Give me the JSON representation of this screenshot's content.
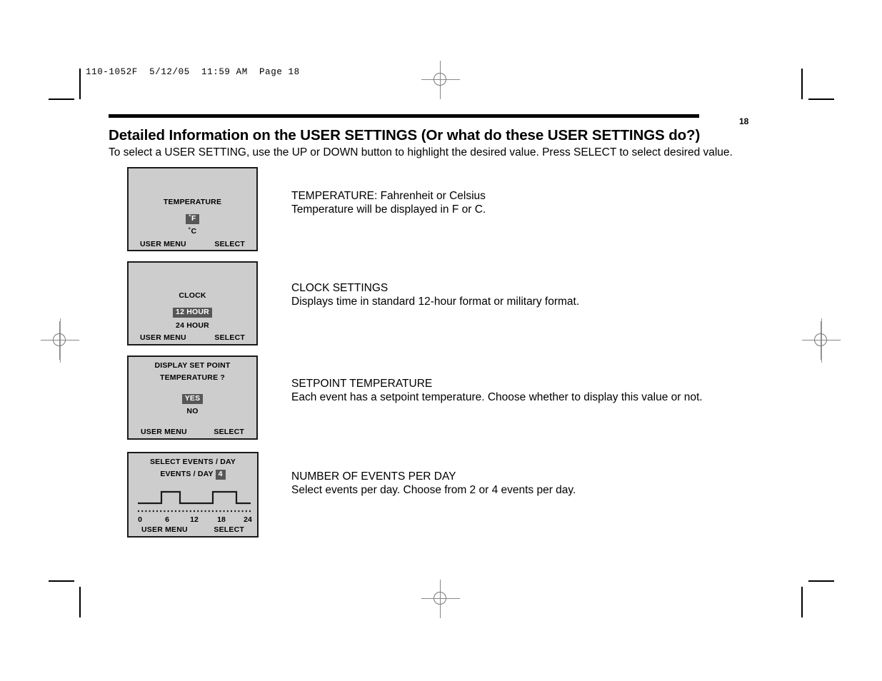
{
  "document": {
    "slug": "110-1052F  5/12/05  11:59 AM  Page 18",
    "page_number": "18",
    "title": "Detailed Information on the USER SETTINGS (Or what do these USER SETTINGS do?)",
    "subtitle": "To select a USER SETTING, use the UP or DOWN button to highlight the desired value. Press SELECT to select desired value."
  },
  "colors": {
    "panel_background": "#cdcdcd",
    "panel_border": "#1a1a1a",
    "highlight_background": "#575757",
    "highlight_text": "#ffffff",
    "page_background": "#ffffff",
    "text": "#000000",
    "crop_mark": "#000000",
    "registration_mark": "#888888"
  },
  "footer_buttons": {
    "left_label": "USER MENU",
    "right_label": "SELECT"
  },
  "panels": [
    {
      "id": "temperature",
      "title": "TEMPERATURE",
      "options": [
        {
          "label": "˚F",
          "selected": true
        },
        {
          "label": "˚C",
          "selected": false
        }
      ],
      "footer": {
        "left": "USER MENU",
        "right": "SELECT"
      }
    },
    {
      "id": "clock",
      "title": "CLOCK",
      "options": [
        {
          "label": "12 HOUR",
          "selected": true
        },
        {
          "label": "24 HOUR",
          "selected": false
        }
      ],
      "footer": {
        "left": "USER MENU",
        "right": "SELECT"
      }
    },
    {
      "id": "display-set-point",
      "title_line1": "DISPLAY SET POINT",
      "title_line2": "TEMPERATURE ?",
      "options": [
        {
          "label": "YES",
          "selected": true
        },
        {
          "label": "NO",
          "selected": false
        }
      ],
      "footer": {
        "left": "USER MENU",
        "right": "SELECT"
      }
    },
    {
      "id": "select-events-per-day",
      "title_line1": "SELECT EVENTS / DAY",
      "title_line2_label": "EVENTS / DAY",
      "title_line2_value": "4",
      "footer": {
        "left": "USER MENU",
        "right": "SELECT"
      }
    }
  ],
  "chart_data": {
    "type": "line",
    "title": "SELECT EVENTS / DAY",
    "xlabel": "",
    "ylabel": "",
    "xlim": [
      0,
      24
    ],
    "ylim": [
      0,
      1
    ],
    "grid": false,
    "legend": "none",
    "tick_labels": [
      "0",
      "6",
      "12",
      "18",
      "24"
    ],
    "ticks": [
      0,
      6,
      12,
      18,
      24
    ],
    "series": [
      {
        "name": "schedule",
        "step": "post",
        "x": [
          0,
          5,
          5,
          9,
          9,
          16,
          16,
          21,
          21,
          24
        ],
        "y": [
          0,
          0,
          1,
          1,
          0,
          0,
          1,
          1,
          0,
          0
        ]
      }
    ],
    "events_per_day": 4,
    "annotations": [
      "dotted baseline under waveform"
    ]
  },
  "descriptions": [
    {
      "id": "temperature",
      "line1": "TEMPERATURE: Fahrenheit or Celsius",
      "line2": "Temperature will be displayed in F or C."
    },
    {
      "id": "clock",
      "line1": "CLOCK SETTINGS",
      "line2": "Displays time in standard 12-hour format or military format."
    },
    {
      "id": "setpoint",
      "line1": "SETPOINT TEMPERATURE",
      "line2": "Each event has a setpoint temperature. Choose whether to display this value or not."
    },
    {
      "id": "events",
      "line1": "NUMBER OF EVENTS PER DAY",
      "line2": "Select events per day. Choose from 2 or 4 events per day."
    }
  ]
}
